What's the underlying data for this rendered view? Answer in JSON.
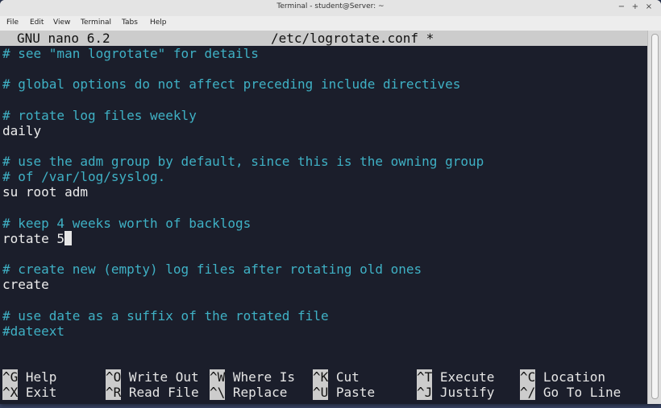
{
  "window": {
    "title": "Terminal - student@Server: ~",
    "controls": {
      "minimize": "−",
      "maximize": "+",
      "close": "×"
    }
  },
  "menubar": [
    "File",
    "Edit",
    "View",
    "Terminal",
    "Tabs",
    "Help"
  ],
  "nano": {
    "version": "GNU nano 6.2",
    "filename": "/etc/logrotate.conf *"
  },
  "lines": [
    {
      "text": "# see \"man logrotate\" for details",
      "type": "comment"
    },
    {
      "text": "",
      "type": "blank"
    },
    {
      "text": "# global options do not affect preceding include directives",
      "type": "comment"
    },
    {
      "text": "",
      "type": "blank"
    },
    {
      "text": "# rotate log files weekly",
      "type": "comment"
    },
    {
      "text": "daily",
      "type": "code"
    },
    {
      "text": "",
      "type": "blank"
    },
    {
      "text": "# use the adm group by default, since this is the owning group",
      "type": "comment"
    },
    {
      "text": "# of /var/log/syslog.",
      "type": "comment"
    },
    {
      "text": "su root adm",
      "type": "code"
    },
    {
      "text": "",
      "type": "blank"
    },
    {
      "text": "# keep 4 weeks worth of backlogs",
      "type": "comment"
    },
    {
      "text": "rotate 5",
      "type": "code"
    },
    {
      "text": "",
      "type": "blank"
    },
    {
      "text": "# create new (empty) log files after rotating old ones",
      "type": "comment"
    },
    {
      "text": "create",
      "type": "code"
    },
    {
      "text": "",
      "type": "blank"
    },
    {
      "text": "# use date as a suffix of the rotated file",
      "type": "comment"
    },
    {
      "text": "#dateext",
      "type": "comment"
    }
  ],
  "shortcuts": [
    {
      "key": "^G",
      "label": "Help"
    },
    {
      "key": "^O",
      "label": "Write Out"
    },
    {
      "key": "^W",
      "label": "Where Is"
    },
    {
      "key": "^K",
      "label": "Cut"
    },
    {
      "key": "^T",
      "label": "Execute"
    },
    {
      "key": "^C",
      "label": "Location"
    },
    {
      "key": "^X",
      "label": "Exit"
    },
    {
      "key": "^R",
      "label": "Read File"
    },
    {
      "key": "^\\",
      "label": "Replace"
    },
    {
      "key": "^U",
      "label": "Paste"
    },
    {
      "key": "^J",
      "label": "Justify"
    },
    {
      "key": "^/",
      "label": "Go To Line"
    }
  ],
  "colors": {
    "terminal_bg": "#1b1e2b",
    "comment": "#3fb1c5",
    "text": "#ececec",
    "header_bg": "#cccccc"
  }
}
